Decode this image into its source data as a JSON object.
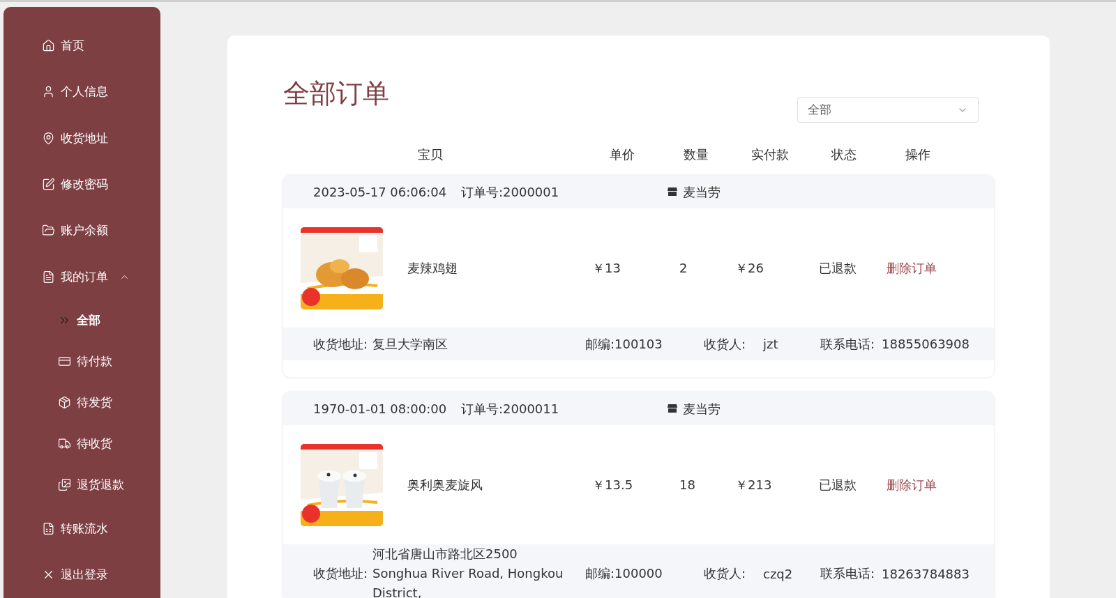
{
  "sidebar": {
    "items": [
      {
        "label": "首页"
      },
      {
        "label": "个人信息"
      },
      {
        "label": "收货地址"
      },
      {
        "label": "修改密码"
      },
      {
        "label": "账户余额"
      },
      {
        "label": "我的订单",
        "expanded": true,
        "children": [
          {
            "label": "全部",
            "selected": true
          },
          {
            "label": "待付款",
            "selected": false
          },
          {
            "label": "待发货",
            "selected": false
          },
          {
            "label": "待收货",
            "selected": false
          },
          {
            "label": "退货退款",
            "selected": false
          }
        ]
      },
      {
        "label": "转账流水"
      },
      {
        "label": "退出登录"
      }
    ]
  },
  "page_title": "全部订单",
  "filter": {
    "value": "全部"
  },
  "columns": [
    "宝贝",
    "单价",
    "数量",
    "实付款",
    "状态",
    "操作"
  ],
  "orders": [
    {
      "time": "2023-05-17 06:06:04",
      "order_no": "订单号:2000001",
      "store": "麦当劳",
      "item": {
        "name": "麦辣鸡翅",
        "price": "￥13",
        "quantity": "2",
        "paid": "￥26",
        "status": "已退款",
        "action": "删除订单"
      },
      "address": {
        "label": "收货地址:",
        "value": "复旦大学南区",
        "zip": "邮编:100103",
        "receiver_label": "收货人:",
        "receiver": "jzt",
        "phone_label": "联系电话:",
        "phone": "18855063908"
      }
    },
    {
      "time": "1970-01-01 08:00:00",
      "order_no": "订单号:2000011",
      "store": "麦当劳",
      "item": {
        "name": "奥利奥麦旋风",
        "price": "￥13.5",
        "quantity": "18",
        "paid": "￥213",
        "status": "已退款",
        "action": "删除订单"
      },
      "address": {
        "label": "收货地址:",
        "value": "河北省唐山市路北区2500 Songhua River Road, Hongkou District,",
        "zip": "邮编:100000",
        "receiver_label": "收货人:",
        "receiver": "czq2",
        "phone_label": "联系电话:",
        "phone": "18263784883"
      }
    }
  ]
}
